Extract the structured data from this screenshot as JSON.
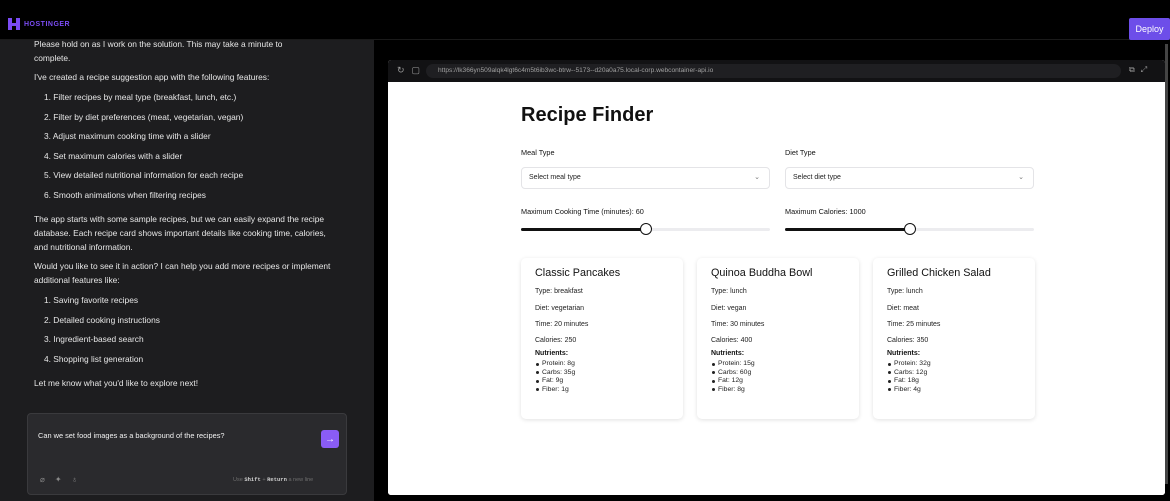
{
  "topbar": {
    "brand": "HOSTINGER",
    "deploy_label": "Deploy",
    "brand_color": "#7b4cf4",
    "deploy_color": "#6d4ee9"
  },
  "chat": {
    "cut_line": "Please hold on as I work on the solution. This may take a minute to",
    "cut_line_end": "complete.",
    "intro": "I've created a recipe suggestion app with the following features:",
    "features": [
      "1. Filter recipes by meal type (breakfast, lunch, etc.)",
      "2. Filter by diet preferences (meat, vegetarian, vegan)",
      "3. Adjust maximum cooking time with a slider",
      "4. Set maximum calories with a slider",
      "5. View detailed nutritional information for each recipe",
      "6. Smooth animations when filtering recipes"
    ],
    "para2": "The app starts with some sample recipes, but we can easily expand the recipe database. Each recipe card shows important details like cooking time, calories, and nutritional information.",
    "para3": "Would you like to see it in action? I can help you add more recipes or implement additional features like:",
    "more_features": [
      "1. Saving favorite recipes",
      "2. Detailed cooking instructions",
      "3. Ingredient-based search",
      "4. Shopping list generation"
    ],
    "closing": "Let me know what you'd like to explore next!",
    "composer_value": "Can we set food images as a background of the recipes?",
    "hint_use": "Use",
    "hint_shift": "Shift",
    "hint_plus": "+",
    "hint_return": "Return",
    "hint_end": "a new line",
    "icons": [
      "paperclip-icon",
      "sparkle-icon",
      "microphone-icon"
    ]
  },
  "browser": {
    "url": "https://lk366yn509alqk4lgt6c4m5t6ib3wc-btrw--5173--d20a0a75.local-corp.webcontainer-api.io"
  },
  "app": {
    "title": "Recipe Finder",
    "meal_label": "Meal Type",
    "meal_placeholder": "Select meal type",
    "diet_label": "Diet Type",
    "diet_placeholder": "Select diet type",
    "time_label": "Maximum Cooking Time (minutes): 60",
    "time_fraction": 0.5,
    "cal_label": "Maximum Calories: 1000",
    "cal_fraction": 0.5,
    "nutrients_label": "Nutrients:",
    "recipes": [
      {
        "name": "Classic Pancakes",
        "type": "Type: breakfast",
        "diet": "Diet: vegetarian",
        "time": "Time: 20 minutes",
        "calories": "Calories: 250",
        "nutrients": [
          "Protein: 8g",
          "Carbs: 35g",
          "Fat: 9g",
          "Fiber: 1g"
        ]
      },
      {
        "name": "Quinoa Buddha Bowl",
        "type": "Type: lunch",
        "diet": "Diet: vegan",
        "time": "Time: 30 minutes",
        "calories": "Calories: 400",
        "nutrients": [
          "Protein: 15g",
          "Carbs: 60g",
          "Fat: 12g",
          "Fiber: 8g"
        ]
      },
      {
        "name": "Grilled Chicken Salad",
        "type": "Type: lunch",
        "diet": "Diet: meat",
        "time": "Time: 25 minutes",
        "calories": "Calories: 350",
        "nutrients": [
          "Protein: 32g",
          "Carbs: 12g",
          "Fat: 18g",
          "Fiber: 4g"
        ]
      }
    ]
  }
}
